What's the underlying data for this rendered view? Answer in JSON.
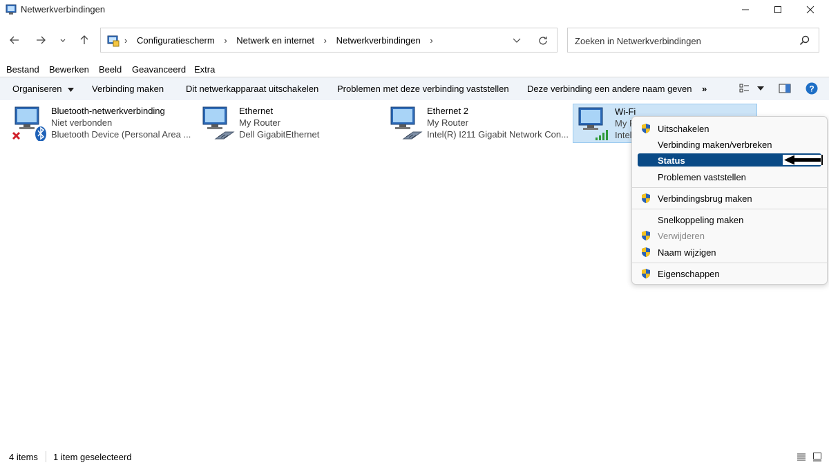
{
  "window": {
    "title": "Netwerkverbindingen"
  },
  "address": {
    "crumbs": [
      "Configuratiescherm",
      "Netwerk en internet",
      "Netwerkverbindingen"
    ]
  },
  "search": {
    "placeholder": "Zoeken in Netwerkverbindingen"
  },
  "menubar": [
    "Bestand",
    "Bewerken",
    "Beeld",
    "Geavanceerd",
    "Extra"
  ],
  "commands": {
    "organize": "Organiseren",
    "connect": "Verbinding maken",
    "disable": "Dit netwerkapparaat uitschakelen",
    "diagnose": "Problemen met deze verbinding vaststellen",
    "rename": "Deze verbinding een andere naam geven",
    "more": "»"
  },
  "items": [
    {
      "name": "Bluetooth-netwerkverbinding",
      "status": "Niet verbonden",
      "device": "Bluetooth Device (Personal Area ..."
    },
    {
      "name": "Ethernet",
      "status": "My Router",
      "device": "Dell GigabitEthernet"
    },
    {
      "name": "Ethernet 2",
      "status": "My Router",
      "device": "Intel(R) I211 Gigabit Network Con..."
    },
    {
      "name": "Wi-Fi",
      "status": "My R",
      "device": "Intel"
    }
  ],
  "context_menu": [
    {
      "label": "Uitschakelen",
      "shield": true
    },
    {
      "label": "Verbinding maken/verbreken",
      "shield": false
    },
    {
      "label": "Status",
      "shield": false,
      "highlighted": true
    },
    {
      "label": "Problemen vaststellen",
      "shield": false
    },
    {
      "label": "Verbindingsbrug maken",
      "shield": true
    },
    {
      "label": "Snelkoppeling maken",
      "shield": false
    },
    {
      "label": "Verwijderen",
      "shield": true,
      "disabled": true
    },
    {
      "label": "Naam wijzigen",
      "shield": true
    },
    {
      "label": "Eigenschappen",
      "shield": true
    }
  ],
  "statusbar": {
    "count": "4 items",
    "selected": "1 item geselecteerd"
  },
  "colors": {
    "accent": "#0a4a86",
    "selection": "#cce4f7",
    "commandbar": "#f0f4f9"
  }
}
